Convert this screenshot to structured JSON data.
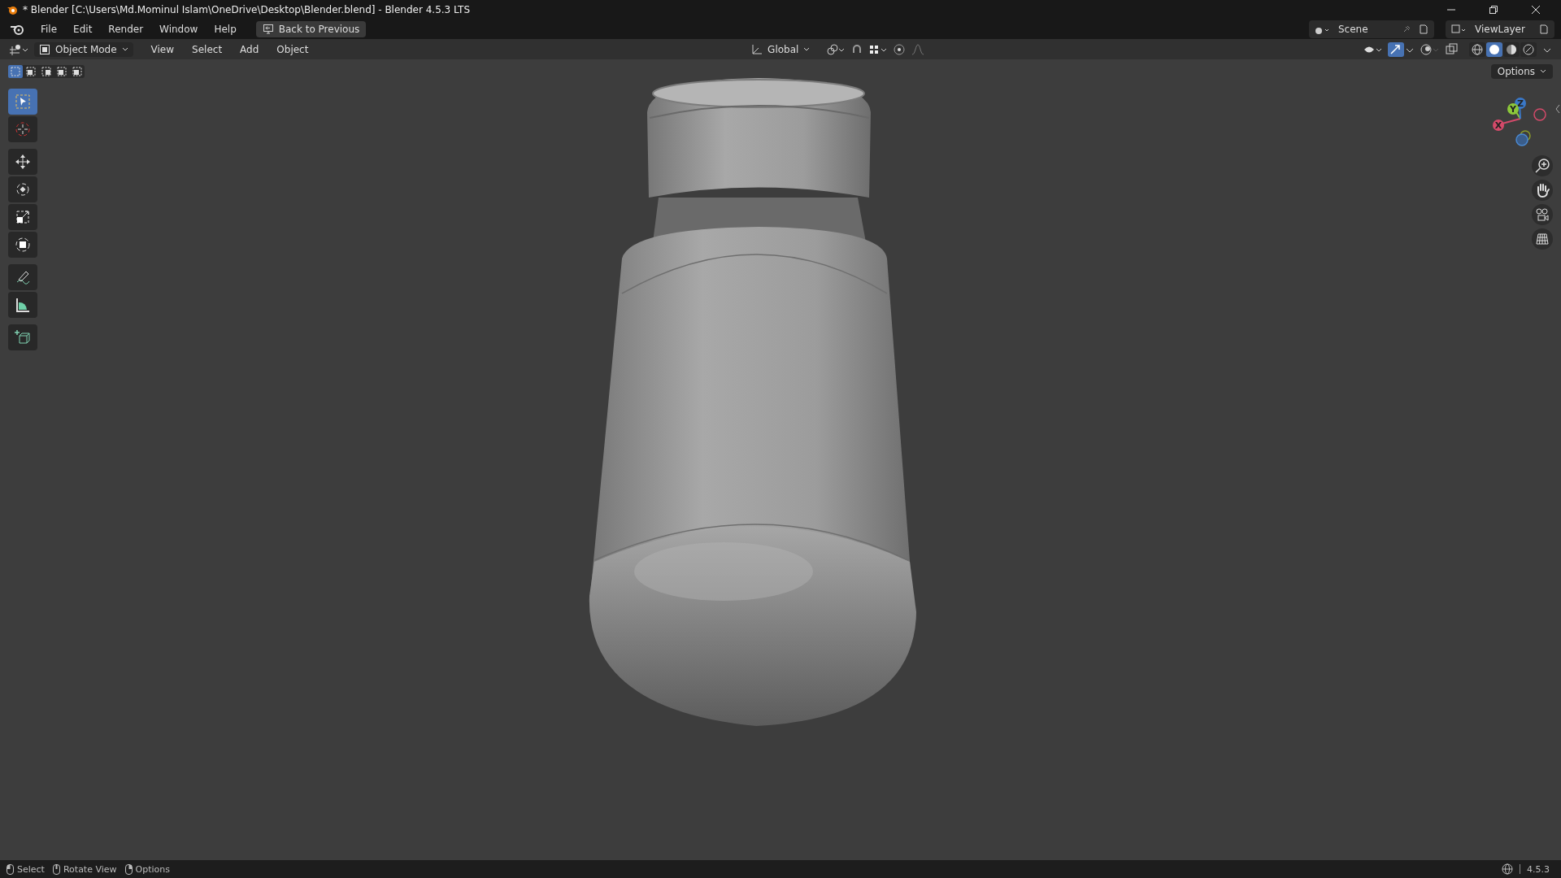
{
  "window": {
    "title": "* Blender [C:\\Users\\Md.Mominul Islam\\OneDrive\\Desktop\\Blender.blend] - Blender 4.5.3 LTS"
  },
  "menu": [
    "File",
    "Edit",
    "Render",
    "Window",
    "Help"
  ],
  "back_button": "Back to Previous",
  "scene": {
    "name": "Scene"
  },
  "view_layer": {
    "name": "ViewLayer"
  },
  "header": {
    "mode": "Object Mode",
    "menus": [
      "View",
      "Select",
      "Add",
      "Object"
    ],
    "orientation": "Global"
  },
  "select_modes": [
    {
      "selected": true
    },
    {
      "selected": false
    },
    {
      "selected": false
    },
    {
      "selected": false
    },
    {
      "selected": false
    }
  ],
  "shading_modes": [
    {
      "kind": "wireframe",
      "selected": false
    },
    {
      "kind": "solid",
      "selected": true
    },
    {
      "kind": "material",
      "selected": false
    },
    {
      "kind": "rendered",
      "selected": false
    }
  ],
  "options_button": "Options",
  "tools": [
    {
      "kind": "select",
      "selected": true
    },
    {
      "kind": "cursor",
      "selected": false
    },
    {
      "kind": "move",
      "selected": false
    },
    {
      "kind": "rotate",
      "selected": false
    },
    {
      "kind": "scale",
      "selected": false
    },
    {
      "kind": "transform",
      "selected": false
    },
    {
      "kind": "annotate",
      "selected": false
    },
    {
      "kind": "measure",
      "selected": false
    },
    {
      "kind": "add-cube",
      "selected": false
    }
  ],
  "gizmo": {
    "x": "X",
    "y": "Y",
    "z": "Z"
  },
  "status_bar": {
    "hints": [
      "Select",
      "Rotate View",
      "Options"
    ],
    "version": "4.5.3"
  }
}
